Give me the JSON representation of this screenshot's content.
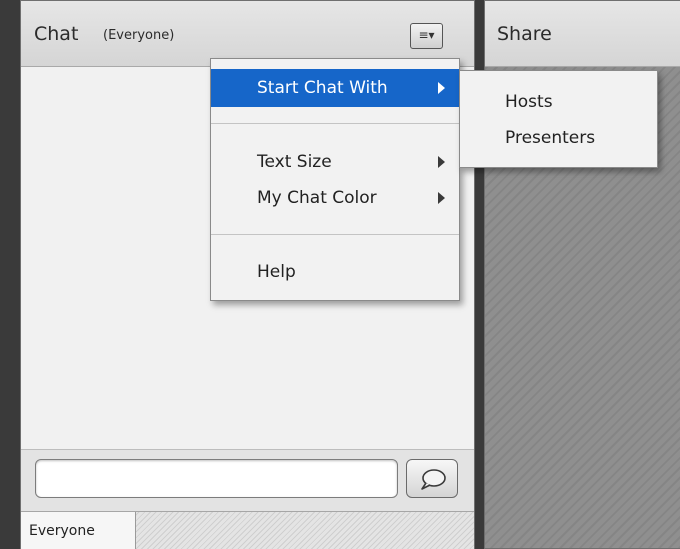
{
  "chat_pod": {
    "title": "Chat",
    "subtitle": "(Everyone)",
    "menu_button_glyph": "≡▾",
    "input": {
      "value": "",
      "placeholder": ""
    },
    "tabs": [
      {
        "label": "Everyone",
        "active": true
      }
    ]
  },
  "share_pod": {
    "title": "Share"
  },
  "pod_menu": {
    "items": [
      {
        "label": "Start Chat With",
        "has_submenu": true,
        "highlighted": true
      },
      {
        "label": "Text Size",
        "has_submenu": true
      },
      {
        "label": "My Chat Color",
        "has_submenu": true
      },
      {
        "label": "Help",
        "has_submenu": false
      }
    ]
  },
  "submenu": {
    "items": [
      {
        "label": "Hosts"
      },
      {
        "label": "Presenters"
      }
    ]
  },
  "colors": {
    "highlight": "#1666c9",
    "pod_background": "#ededed",
    "share_background": "#8a8a8a"
  },
  "icons": {
    "pod_menu": "hamburger-menu-icon",
    "send": "speech-bubble-icon",
    "submenu": "chevron-right-icon"
  }
}
